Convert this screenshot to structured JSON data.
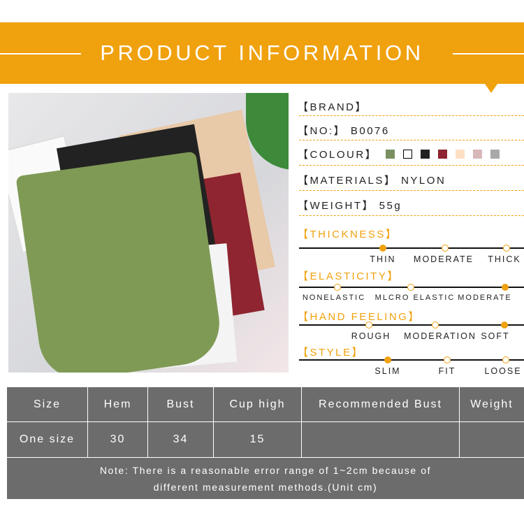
{
  "header": {
    "title": "PRODUCT INFORMATION"
  },
  "info": {
    "brand_label": "【BRAND】",
    "no_label": "【NO:】",
    "no_value": "B0076",
    "colour_label": "【COLOUR】",
    "colours": [
      "#7a9060",
      "#ffffff",
      "#222222",
      "#8e2530",
      "#fde0c4",
      "#d8b8b8",
      "#a8a8a8"
    ],
    "materials_label": "【MATERIALS】",
    "materials_value": "NYLON",
    "weight_label": "【WEIGHT】",
    "weight_value": "55g"
  },
  "scales": [
    {
      "title": "【THICKNESS】",
      "options": [
        "THIN",
        "MODERATE",
        "THICK"
      ],
      "selected": "THIN"
    },
    {
      "title": "【ELASTICITY】",
      "options": [
        "NONELASTIC",
        "MLCRO ELASTIC",
        "MODERATE"
      ],
      "selected": "MODERATE"
    },
    {
      "title": "【HAND FEELING】",
      "options": [
        "ROUGH",
        "MODERATION",
        "SOFT"
      ],
      "selected": "SOFT"
    },
    {
      "title": "【STYLE】",
      "options": [
        "SLIM",
        "FIT",
        "LOOSE"
      ],
      "selected": "SLIM"
    }
  ],
  "table": {
    "headers": [
      "Size",
      "Hem",
      "Bust",
      "Cup high",
      "Recommended Bust",
      "Weight"
    ],
    "rows": [
      [
        "One size",
        "30",
        "34",
        "15",
        "",
        ""
      ]
    ],
    "note_line1": "Note: There is a reasonable error range of 1~2cm because of",
    "note_line2": "different measurement methods.(Unit cm)"
  },
  "accent": "#f0a10e"
}
